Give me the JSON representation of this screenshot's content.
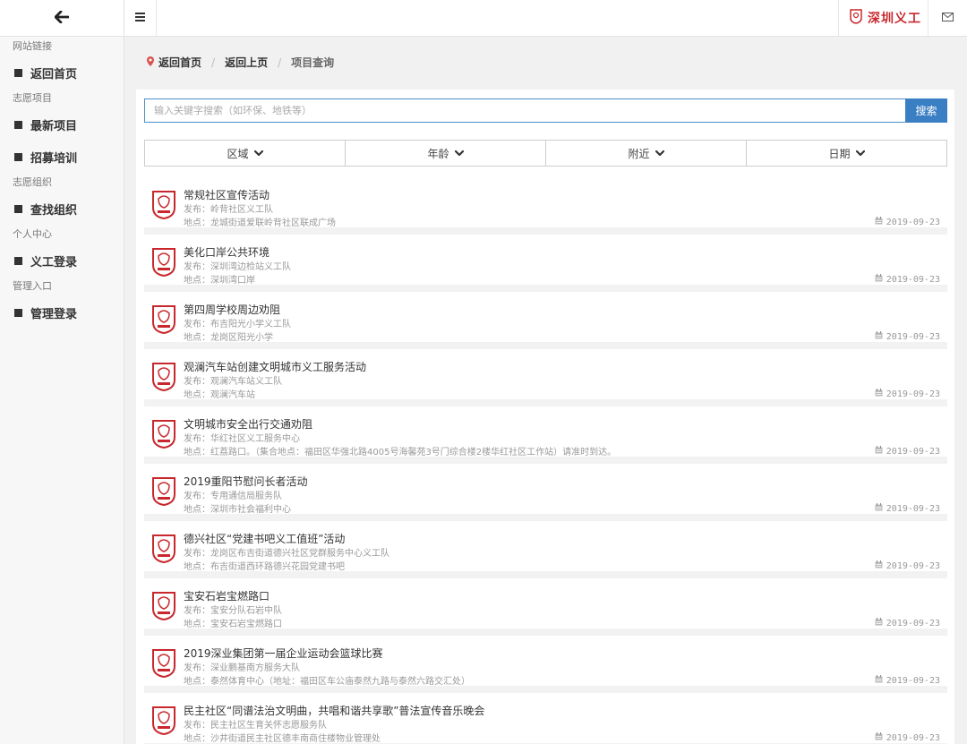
{
  "sidebar": {
    "sections": [
      {
        "label": "网站链接",
        "items": [
          {
            "label": "返回首页"
          }
        ]
      },
      {
        "label": "志愿项目",
        "items": [
          {
            "label": "最新项目"
          },
          {
            "label": "招募培训"
          }
        ]
      },
      {
        "label": "志愿组织",
        "items": [
          {
            "label": "查找组织"
          }
        ]
      },
      {
        "label": "个人中心",
        "items": [
          {
            "label": "义工登录"
          }
        ]
      },
      {
        "label": "管理入口",
        "items": [
          {
            "label": "管理登录"
          }
        ]
      }
    ]
  },
  "header": {
    "brand": "深圳义工"
  },
  "breadcrumb": {
    "home": "返回首页",
    "back": "返回上页",
    "current": "项目查询",
    "sep": "/"
  },
  "search": {
    "placeholder": "输入关键字搜索（如环保、地铁等）",
    "button": "搜索"
  },
  "filters": [
    {
      "label": "区域"
    },
    {
      "label": "年龄"
    },
    {
      "label": "附近"
    },
    {
      "label": "日期"
    }
  ],
  "items": [
    {
      "title": "常规社区宣传活动",
      "publisher": "发布：岭背社区义工队",
      "location": "地点：龙城街道爱联岭背社区联成广场",
      "date": "2019-09-23"
    },
    {
      "title": "美化口岸公共环境",
      "publisher": "发布：深圳湾边检站义工队",
      "location": "地点：深圳湾口岸",
      "date": "2019-09-23"
    },
    {
      "title": "第四周学校周边劝阻",
      "publisher": "发布：布吉阳光小学义工队",
      "location": "地点：龙岗区阳光小学",
      "date": "2019-09-23"
    },
    {
      "title": "观澜汽车站创建文明城市义工服务活动",
      "publisher": "发布：观澜汽车站义工队",
      "location": "地点：观澜汽车站",
      "date": "2019-09-23"
    },
    {
      "title": "文明城市安全出行交通劝阻",
      "publisher": "发布：华红社区义工服务中心",
      "location": "地点：红荔路口。（集合地点：福田区华强北路4005号海馨苑3号门综合楼2楼华红社区工作站）请准时到达。",
      "date": "2019-09-23"
    },
    {
      "title": "2019重阳节慰问长者活动",
      "publisher": "发布：专用通信局服务队",
      "location": "地点：深圳市社会福利中心",
      "date": "2019-09-23"
    },
    {
      "title": "德兴社区“党建书吧义工值班”活动",
      "publisher": "发布：龙岗区布吉街道德兴社区党群服务中心义工队",
      "location": "地点：布吉街道西环路德兴花园党建书吧",
      "date": "2019-09-23"
    },
    {
      "title": "宝安石岩宝燃路口",
      "publisher": "发布：宝安分队石岩中队",
      "location": "地点：宝安石岩宝燃路口",
      "date": "2019-09-23"
    },
    {
      "title": "2019深业集团第一届企业运动会篮球比赛",
      "publisher": "发布：深业鹏基南方服务大队",
      "location": "地点：泰然体育中心（地址：福田区车公庙泰然九路与泰然六路交汇处）",
      "date": "2019-09-23"
    },
    {
      "title": "民主社区“同谱法治文明曲，共唱和谐共享歌”普法宣传音乐晚会",
      "publisher": "发布：民主社区生育关怀志愿服务队",
      "location": "地点：沙井街道民主社区德丰南商住楼物业管理处",
      "date": "2019-09-23"
    }
  ],
  "colors": {
    "accent": "#3a7fc4",
    "brand": "#c8282d"
  }
}
